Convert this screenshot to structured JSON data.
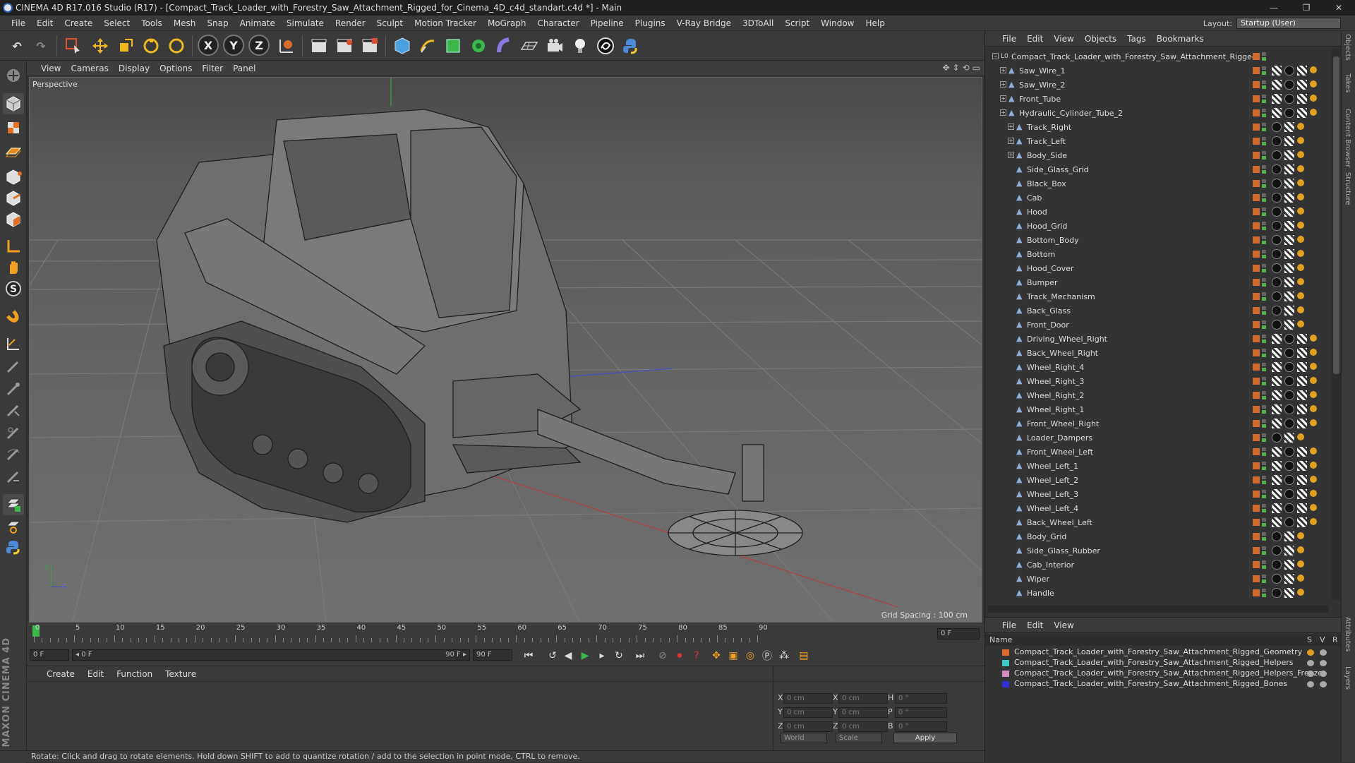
{
  "window": {
    "title": "CINEMA 4D R17.016 Studio (R17) - [Compact_Track_Loader_with_Forestry_Saw_Attachment_Rigged_for_Cinema_4D_c4d_standart.c4d *] - Main",
    "controls": [
      "—",
      "❐",
      "✕"
    ]
  },
  "menubar": [
    "File",
    "Edit",
    "Create",
    "Select",
    "Tools",
    "Mesh",
    "Snap",
    "Animate",
    "Simulate",
    "Render",
    "Sculpt",
    "Motion Tracker",
    "MoGraph",
    "Character",
    "Pipeline",
    "Plugins",
    "V-Ray Bridge",
    "3DToAll",
    "Script",
    "Window",
    "Help"
  ],
  "layout": {
    "label": "Layout:",
    "value": "Startup (User)"
  },
  "toolbar": {
    "undo": "↶",
    "redo": "↷",
    "x": "X",
    "y": "Y",
    "z": "Z"
  },
  "viewport": {
    "menu": [
      "View",
      "Cameras",
      "Display",
      "Options",
      "Filter",
      "Panel"
    ],
    "label": "Perspective",
    "grid_spacing": "Grid Spacing : 100 cm",
    "axis_y": "y",
    "axis_z": "z"
  },
  "timeline": {
    "ticks": [
      "0",
      "5",
      "10",
      "15",
      "20",
      "25",
      "30",
      "35",
      "40",
      "45",
      "50",
      "55",
      "60",
      "65",
      "70",
      "75",
      "80",
      "85",
      "90"
    ],
    "end_label": "0 F"
  },
  "playback": {
    "current": "0 F",
    "range_start": "◂ 0 F",
    "range_end": "90 F ▸",
    "max": "90 F"
  },
  "material_menu": [
    "Create",
    "Edit",
    "Function",
    "Texture"
  ],
  "coords": {
    "rows": [
      {
        "l1": "X",
        "v1": "0 cm",
        "l2": "X",
        "v2": "0 cm",
        "l3": "H",
        "v3": "0 °"
      },
      {
        "l1": "Y",
        "v1": "0 cm",
        "l2": "Y",
        "v2": "0 cm",
        "l3": "P",
        "v3": "0 °"
      },
      {
        "l1": "Z",
        "v1": "0 cm",
        "l2": "Z",
        "v2": "0 cm",
        "l3": "B",
        "v3": "0 °"
      }
    ],
    "world": "World",
    "scale": "Scale",
    "apply": "Apply"
  },
  "status": "Rotate: Click and drag to rotate elements. Hold down SHIFT to add to quantize rotation / add to the selection in point mode, CTRL to remove.",
  "brand": "MAXON CINEMA 4D",
  "object_menu": [
    "File",
    "Edit",
    "View",
    "Objects",
    "Tags",
    "Bookmarks"
  ],
  "objects": [
    {
      "name": "Compact_Track_Loader_with_Forestry_Saw_Attachment_Rigged",
      "depth": 0,
      "expand": "−"
    },
    {
      "name": "Saw_Wire_1",
      "depth": 1,
      "expand": "+"
    },
    {
      "name": "Saw_Wire_2",
      "depth": 1,
      "expand": "+"
    },
    {
      "name": "Front_Tube",
      "depth": 1,
      "expand": "+"
    },
    {
      "name": "Hydraulic_Cylinder_Tube_2",
      "depth": 1,
      "expand": "+"
    },
    {
      "name": "Track_Right",
      "depth": 2,
      "expand": "+"
    },
    {
      "name": "Track_Left",
      "depth": 2,
      "expand": "+"
    },
    {
      "name": "Body_Side",
      "depth": 2,
      "expand": "+"
    },
    {
      "name": "Side_Glass_Grid",
      "depth": 2,
      "expand": ""
    },
    {
      "name": "Black_Box",
      "depth": 2,
      "expand": ""
    },
    {
      "name": "Cab",
      "depth": 2,
      "expand": ""
    },
    {
      "name": "Hood",
      "depth": 2,
      "expand": ""
    },
    {
      "name": "Hood_Grid",
      "depth": 2,
      "expand": ""
    },
    {
      "name": "Bottom_Body",
      "depth": 2,
      "expand": ""
    },
    {
      "name": "Bottom",
      "depth": 2,
      "expand": ""
    },
    {
      "name": "Hood_Cover",
      "depth": 2,
      "expand": ""
    },
    {
      "name": "Bumper",
      "depth": 2,
      "expand": ""
    },
    {
      "name": "Track_Mechanism",
      "depth": 2,
      "expand": ""
    },
    {
      "name": "Back_Glass",
      "depth": 2,
      "expand": ""
    },
    {
      "name": "Front_Door",
      "depth": 2,
      "expand": ""
    },
    {
      "name": "Driving_Wheel_Right",
      "depth": 2,
      "expand": ""
    },
    {
      "name": "Back_Wheel_Right",
      "depth": 2,
      "expand": ""
    },
    {
      "name": "Wheel_Right_4",
      "depth": 2,
      "expand": ""
    },
    {
      "name": "Wheel_Right_3",
      "depth": 2,
      "expand": ""
    },
    {
      "name": "Wheel_Right_2",
      "depth": 2,
      "expand": ""
    },
    {
      "name": "Wheel_Right_1",
      "depth": 2,
      "expand": ""
    },
    {
      "name": "Front_Wheel_Right",
      "depth": 2,
      "expand": ""
    },
    {
      "name": "Loader_Dampers",
      "depth": 2,
      "expand": ""
    },
    {
      "name": "Front_Wheel_Left",
      "depth": 2,
      "expand": ""
    },
    {
      "name": "Wheel_Left_1",
      "depth": 2,
      "expand": ""
    },
    {
      "name": "Wheel_Left_2",
      "depth": 2,
      "expand": ""
    },
    {
      "name": "Wheel_Left_3",
      "depth": 2,
      "expand": ""
    },
    {
      "name": "Wheel_Left_4",
      "depth": 2,
      "expand": ""
    },
    {
      "name": "Back_Wheel_Left",
      "depth": 2,
      "expand": ""
    },
    {
      "name": "Body_Grid",
      "depth": 2,
      "expand": ""
    },
    {
      "name": "Side_Glass_Rubber",
      "depth": 2,
      "expand": ""
    },
    {
      "name": "Cab_Interior",
      "depth": 2,
      "expand": ""
    },
    {
      "name": "Wiper",
      "depth": 2,
      "expand": ""
    },
    {
      "name": "Handle",
      "depth": 2,
      "expand": ""
    }
  ],
  "layer_menu": [
    "File",
    "Edit",
    "View"
  ],
  "layers": {
    "header": "Name",
    "header_cols": [
      "S",
      "V",
      "R"
    ],
    "items": [
      {
        "name": "Compact_Track_Loader_with_Forestry_Saw_Attachment_Rigged_Geometry",
        "color": "#d86a2c"
      },
      {
        "name": "Compact_Track_Loader_with_Forestry_Saw_Attachment_Rigged_Helpers",
        "color": "#3ec8c8"
      },
      {
        "name": "Compact_Track_Loader_with_Forestry_Saw_Attachment_Rigged_Helpers_Freeze",
        "color": "#d48cc0"
      },
      {
        "name": "Compact_Track_Loader_with_Forestry_Saw_Attachment_Rigged_Bones",
        "color": "#3030d0"
      }
    ]
  },
  "side_tabs": [
    "Objects",
    "Takes",
    "Content Browser",
    "Structure",
    "Attributes",
    "Layers"
  ]
}
